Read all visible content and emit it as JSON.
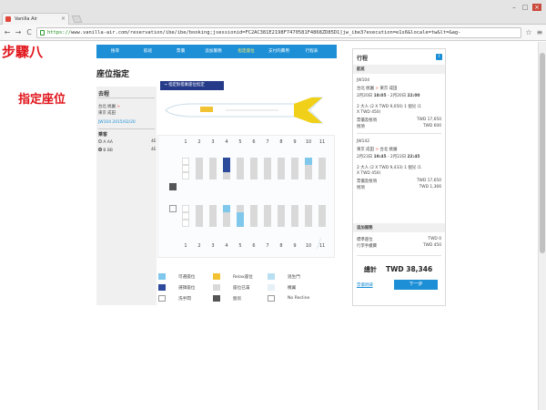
{
  "browser": {
    "tab_title": "Vanilla Air",
    "url_scheme": "https://",
    "url_rest": "www.vanilla-air.com/reservation/ibe/ibe/booking;jsessionid=FC2AC381E2198F7470581F4868ZD85D1]jw_ibe3?execution=e1s6&locale=tw&lt=&ag-",
    "win_min": "–",
    "win_max": "□",
    "win_close": "×",
    "tab_close": "×",
    "nav_back": "←",
    "nav_forward": "→",
    "nav_reload": "C",
    "star": "☆",
    "menu": "≡"
  },
  "annotations": {
    "step": "步驟八",
    "task": "指定座位"
  },
  "site_nav": {
    "items": [
      {
        "label": "搜尋"
      },
      {
        "label": "航班"
      },
      {
        "label": "票價"
      },
      {
        "label": "追加服務"
      },
      {
        "label": "指定座位"
      },
      {
        "label": "支付的費用"
      },
      {
        "label": "行程表"
      }
    ]
  },
  "page": {
    "title": "座位指定",
    "instruction_button": "→ 指定對搭乘座位指定",
    "sidebar_heading": "去程",
    "route_from": "台北 桃園",
    "route_arrow": ">",
    "route_to": "東京 成田",
    "flight_date": "JW104 2015/02/20",
    "passengers_heading": "乘客",
    "passengers": [
      {
        "name": "A AA",
        "code": "4E",
        "selected": false
      },
      {
        "name": "B BB",
        "code": "4E",
        "selected": true
      }
    ]
  },
  "seatmap": {
    "columns": [
      "1",
      "2",
      "3",
      "4",
      "5",
      "6",
      "7",
      "8",
      "9",
      "10",
      "11"
    ],
    "rows": [
      [
        "wh",
        "un",
        "un",
        "sel",
        "un",
        "un",
        "un",
        "un",
        "un",
        "av",
        "un"
      ],
      [
        "wh",
        "un",
        "un",
        "sel",
        "un",
        "un",
        "un",
        "un",
        "un",
        "un",
        "un"
      ],
      [
        "wh",
        "un",
        "un",
        "un",
        "un",
        "un",
        "un",
        "un",
        "un",
        "un",
        "un"
      ],
      [
        "wh",
        "un",
        "un",
        "av",
        "un",
        "un",
        "un",
        "un",
        "un",
        "un",
        "un"
      ],
      [
        "wh",
        "un",
        "un",
        "un",
        "av",
        "un",
        "un",
        "un",
        "un",
        "un",
        "un"
      ],
      [
        "wh",
        "un",
        "un",
        "un",
        "av",
        "un",
        "un",
        "un",
        "un",
        "un",
        "un"
      ]
    ]
  },
  "legend": [
    {
      "color": "#7fc8ec",
      "label": "可選座位"
    },
    {
      "color": "#f1c232",
      "label": "Relax座位"
    },
    {
      "color": "#b9dff3",
      "label": "逃生門"
    },
    {
      "color": "#2d4a9c",
      "label": "選擇座位"
    },
    {
      "color": "#d9d9d9",
      "label": "座位已滿"
    },
    {
      "color": "#e6f0f7",
      "label": "機翼"
    },
    {
      "color": "#ffffff",
      "label": "洗手間"
    },
    {
      "color": "#555555",
      "label": "廚房"
    },
    {
      "color": "#ffffff",
      "label": "No Recline"
    }
  ],
  "itinerary": {
    "heading": "行程",
    "info_icon": "i",
    "flight_section": "航班",
    "flights": [
      {
        "number": "JW104",
        "from": "台北 桃園",
        "arrow": ">",
        "to": "東京 成田",
        "time_pre": "2月20日 ",
        "dep_time": "18:05",
        "time_mid": " - 2月20日 ",
        "arr_time": "22:00",
        "fare_line1": "2 大人 (2 X TWD 9,050) 1 個兒 (1",
        "fare_line2": "X TWD 450)",
        "fee_label": "票價及稅項",
        "fee_value": "TWD 17,650",
        "tax_label": "稅項",
        "tax_value": "TWD 600"
      },
      {
        "number": "JW142",
        "from": "東京 成田",
        "arrow": ">",
        "to": "台北 桃園",
        "time_pre": "2月23日 ",
        "dep_time": "19:45",
        "time_mid": " - 2月23日 ",
        "arr_time": "22:45",
        "fare_line1": "2 大人 (2 X TWD 9,433) 1 個兒 (1",
        "fare_line2": "X TWD 450)",
        "fee_label": "票價及稅項",
        "fee_value": "TWD 17,650",
        "tax_label": "稅項",
        "tax_value": "TWD 1,366"
      }
    ],
    "extras_heading": "追加服務",
    "extras": [
      {
        "label": "標準座位",
        "value": "TWD 0"
      },
      {
        "label": "行李手續費",
        "value": "TWD 450"
      }
    ],
    "total_label": "總計",
    "total_value": "TWD 38,346",
    "fee_note_link": "票價明細",
    "next_button": "下一步"
  },
  "colors": {
    "brand_blue": "#1d8fd6",
    "accent_yellow": "#f1c232",
    "annotation_red": "#e0141a",
    "arrow_red": "#e0463a"
  }
}
